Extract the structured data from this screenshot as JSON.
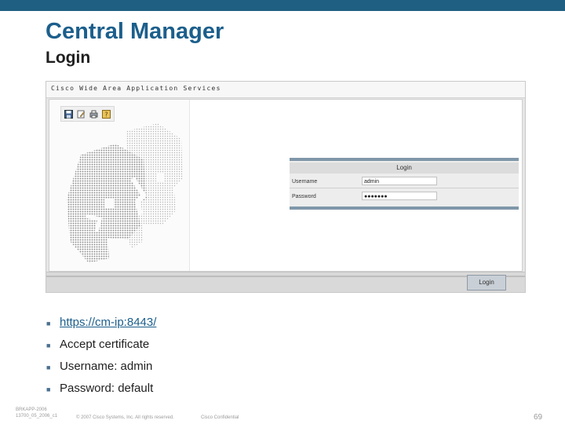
{
  "slide": {
    "title": "Central Manager",
    "subtitle": "Login"
  },
  "screenshot": {
    "app_title": "Cisco Wide Area Application Services",
    "toolbar_icons": [
      "save-icon",
      "edit-icon",
      "print-icon",
      "help-icon"
    ],
    "login_form": {
      "header": "Login",
      "username_label": "Username",
      "username_value": "admin",
      "password_label": "Password",
      "password_value": "●●●●●●●"
    },
    "login_button": "Login"
  },
  "bullets": [
    "https://cm-ip:8443/",
    "Accept certificate",
    "Username: admin",
    "Password: default"
  ],
  "footer": {
    "code_line1": "BRKAPP-2006",
    "code_line2": "13700_05_2006_c1",
    "copyright": "© 2007 Cisco Systems, Inc. All rights reserved.",
    "confidential": "Cisco Confidential",
    "page_number": "69"
  },
  "colors": {
    "top_bar": "#1f5f82",
    "title": "#1c5f8c"
  }
}
